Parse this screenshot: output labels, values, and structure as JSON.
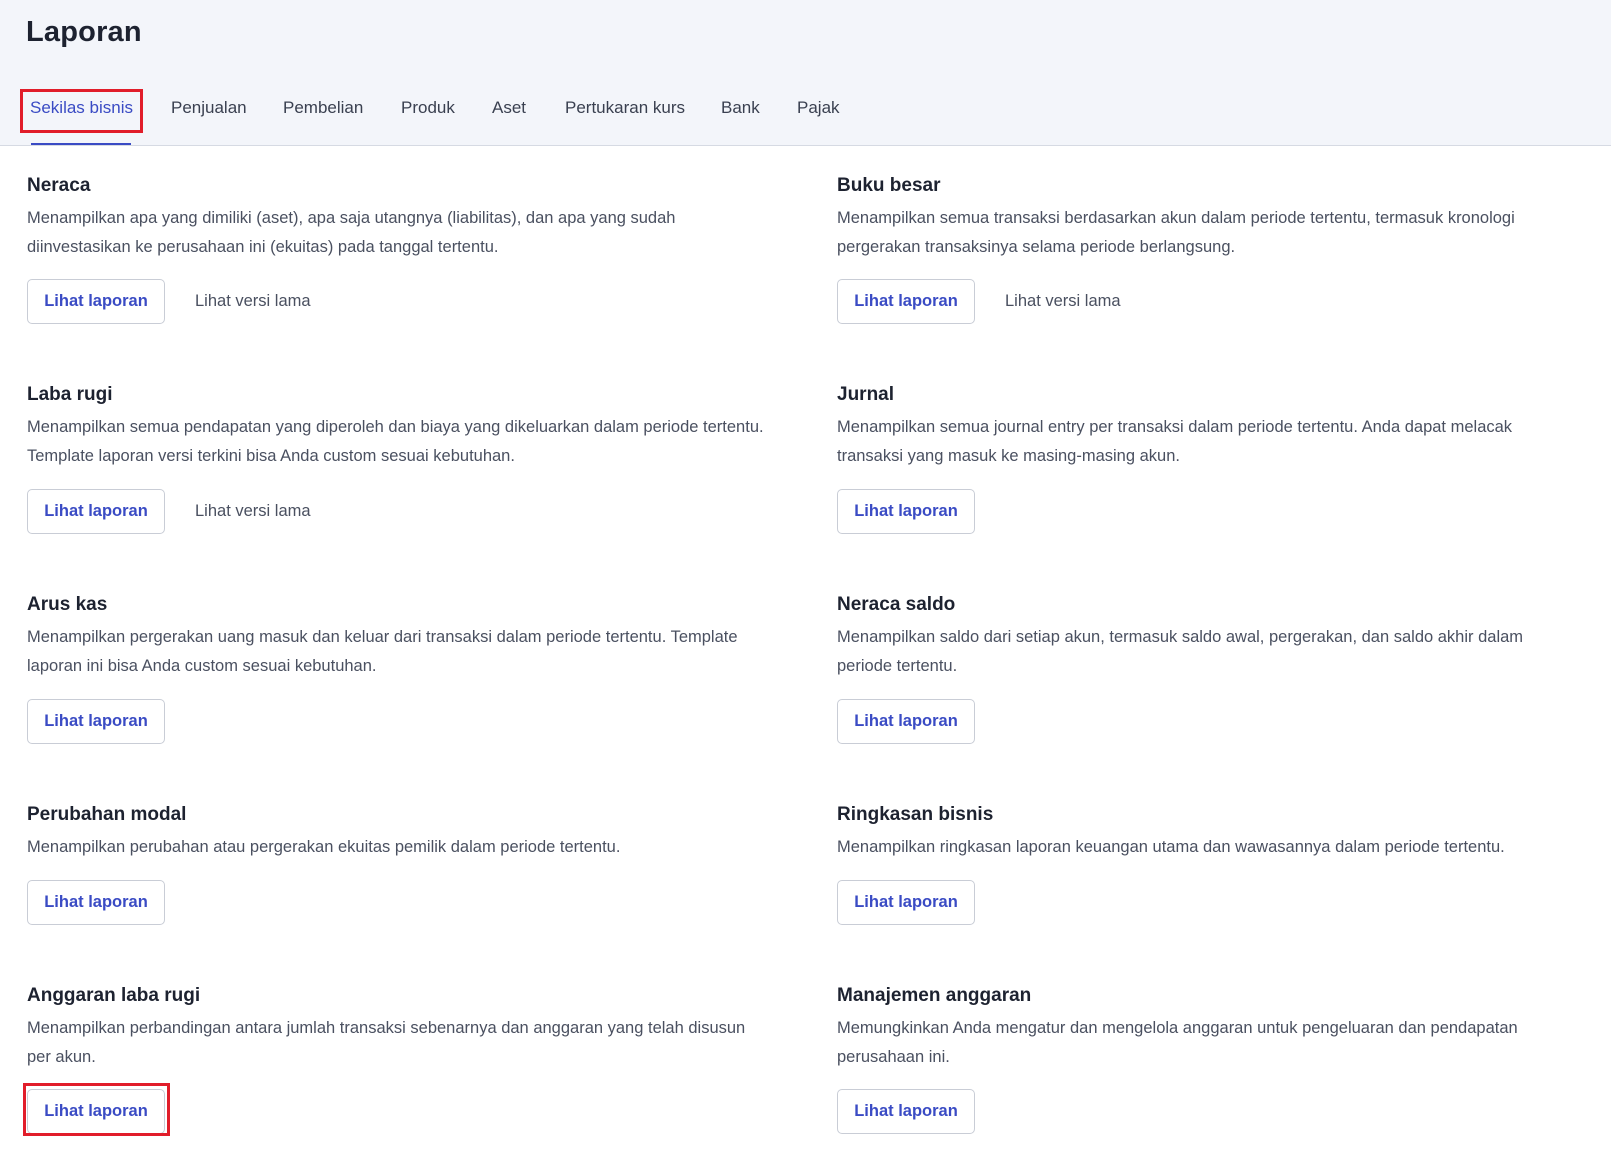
{
  "page": {
    "title": "Laporan"
  },
  "tabs": [
    {
      "label": "Sekilas bisnis",
      "active": true
    },
    {
      "label": "Penjualan"
    },
    {
      "label": "Pembelian"
    },
    {
      "label": "Produk"
    },
    {
      "label": "Aset"
    },
    {
      "label": "Pertukaran kurs"
    },
    {
      "label": "Bank"
    },
    {
      "label": "Pajak"
    }
  ],
  "reports": [
    {
      "title": "Neraca",
      "description": "Menampilkan apa yang dimiliki (aset), apa saja utangnya (liabilitas), dan apa yang sudah diinvestasikan ke perusahaan ini (ekuitas) pada tanggal tertentu.",
      "primary": "Lihat laporan",
      "secondary": "Lihat versi lama"
    },
    {
      "title": "Buku besar",
      "description": "Menampilkan semua transaksi berdasarkan akun dalam periode tertentu, termasuk kronologi pergerakan transaksinya selama periode berlangsung.",
      "primary": "Lihat laporan",
      "secondary": "Lihat versi lama"
    },
    {
      "title": "Laba rugi",
      "description": "Menampilkan semua pendapatan yang diperoleh dan biaya yang dikeluarkan dalam periode tertentu. Template laporan versi terkini bisa Anda custom sesuai kebutuhan.",
      "primary": "Lihat laporan",
      "secondary": "Lihat versi lama"
    },
    {
      "title": "Jurnal",
      "description": "Menampilkan semua journal entry per transaksi dalam periode tertentu. Anda dapat melacak transaksi yang masuk ke masing-masing akun.",
      "primary": "Lihat laporan"
    },
    {
      "title": "Arus kas",
      "description": "Menampilkan pergerakan uang masuk dan keluar dari transaksi dalam periode tertentu. Template laporan ini bisa Anda custom sesuai kebutuhan.",
      "primary": "Lihat laporan"
    },
    {
      "title": "Neraca saldo",
      "description": "Menampilkan saldo dari setiap akun, termasuk saldo awal, pergerakan, dan saldo akhir dalam periode tertentu.",
      "primary": "Lihat laporan"
    },
    {
      "title": "Perubahan modal",
      "description": "Menampilkan perubahan atau pergerakan ekuitas pemilik dalam periode tertentu.",
      "primary": "Lihat laporan"
    },
    {
      "title": "Ringkasan bisnis",
      "description": "Menampilkan ringkasan laporan keuangan utama dan wawasannya dalam periode tertentu.",
      "primary": "Lihat laporan"
    },
    {
      "title": "Anggaran laba rugi",
      "description": "Menampilkan perbandingan antara jumlah transaksi sebenarnya dan anggaran yang telah disusun per akun.",
      "primary": "Lihat laporan"
    },
    {
      "title": "Manajemen anggaran",
      "description": "Memungkinkan Anda mengatur dan mengelola anggaran untuk pengeluaran dan pendapatan perusahaan ini.",
      "primary": "Lihat laporan"
    }
  ],
  "colors": {
    "accent": "#3a4bc4",
    "highlight": "#e11d2a",
    "header_bg": "#f3f5fa"
  }
}
